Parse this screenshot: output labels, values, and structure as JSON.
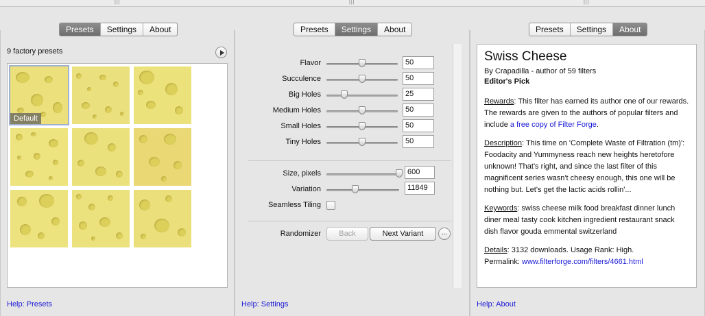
{
  "panels": {
    "presets": {
      "tabs": [
        "Presets",
        "Settings",
        "About"
      ],
      "active_tab": 0,
      "count_text": "9 factory presets",
      "default_label": "Default",
      "help": "Help: Presets"
    },
    "settings": {
      "tabs": [
        "Presets",
        "Settings",
        "About"
      ],
      "active_tab": 1,
      "params": [
        {
          "label": "Flavor",
          "value": "50",
          "level": 0.5
        },
        {
          "label": "Succulence",
          "value": "50",
          "level": 0.5
        },
        {
          "label": "Big Holes",
          "value": "25",
          "level": 0.25
        },
        {
          "label": "Medium Holes",
          "value": "50",
          "level": 0.5
        },
        {
          "label": "Small Holes",
          "value": "50",
          "level": 0.5
        },
        {
          "label": "Tiny Holes",
          "value": "50",
          "level": 0.5
        }
      ],
      "size": {
        "label": "Size, pixels",
        "value": "600",
        "level": 1.0
      },
      "variation": {
        "label": "Variation",
        "value": "11849",
        "level": 0.4
      },
      "seamless": {
        "label": "Seamless Tiling",
        "checked": false
      },
      "randomizer": {
        "label": "Randomizer",
        "back": "Back",
        "next": "Next Variant",
        "more": "..."
      },
      "help": "Help: Settings"
    },
    "about": {
      "tabs": [
        "Presets",
        "Settings",
        "About"
      ],
      "active_tab": 2,
      "title": "Swiss Cheese",
      "byline": "By Crapadilla - author of 59 filters",
      "pick": "Editor's Pick",
      "rewards_head": "Rewards",
      "rewards_text": ": This filter has earned its author one of our rewards. The rewards are given to the authors of popular filters and include ",
      "rewards_link": "a free copy of Filter Forge",
      "rewards_end": ".",
      "description_head": "Description",
      "description_text": ": This time on 'Complete Waste of Filtration (tm)': Foodacity and Yummyness reach new heights heretofore unknown! That's right, and since the last filter of this magnificent series wasn't cheesy enough, this one will be nothing but. Let's get the lactic acids rollin'...",
      "keywords_head": "Keywords",
      "keywords_text": ": swiss cheese milk food breakfast dinner lunch diner meal tasty cook kitchen ingredient restaurant snack dish flavor gouda emmental switzerland",
      "details_head": "Details",
      "details_text": ": 3132 downloads. Usage Rank: High.",
      "permalink_label": "Permalink: ",
      "permalink": "www.filterforge.com/filters/4661.html",
      "help": "Help: About"
    }
  },
  "colors": {
    "cheese": "#ede27e",
    "hole": "#dccf5a",
    "link": "#1a1ad6",
    "active_tab": "#7a7a7a"
  }
}
